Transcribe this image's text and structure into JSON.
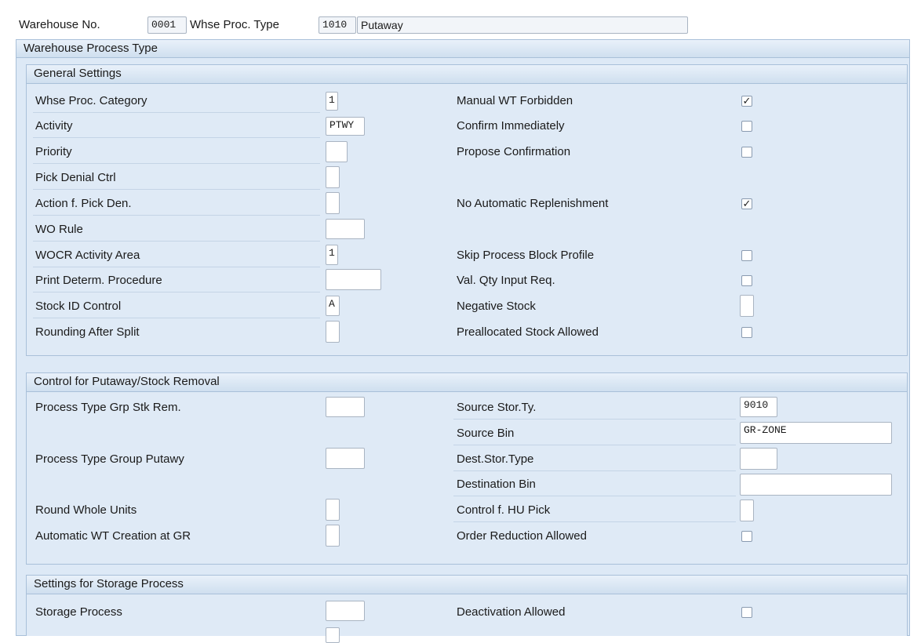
{
  "header": {
    "warehouse_no_label": "Warehouse No.",
    "warehouse_no_value": "0001",
    "proc_type_label": "Whse Proc. Type",
    "proc_type_value": "1010",
    "proc_type_desc": "Putaway"
  },
  "main_panel_title": "Warehouse Process Type",
  "general": {
    "title": "General Settings",
    "rows": [
      {
        "label": "Whse Proc. Category",
        "value": "1"
      },
      {
        "label": "Activity",
        "value": "PTWY"
      },
      {
        "label": "Priority",
        "value": ""
      },
      {
        "label": "Pick Denial Ctrl",
        "value": ""
      },
      {
        "label": "Action f. Pick Den.",
        "value": ""
      },
      {
        "label": "WO Rule",
        "value": ""
      },
      {
        "label": "WOCR Activity Area",
        "value": "1"
      },
      {
        "label": "Print Determ. Procedure",
        "value": ""
      },
      {
        "label": "Stock ID Control",
        "value": "A"
      },
      {
        "label": "Rounding After Split",
        "value": ""
      }
    ],
    "checks": [
      {
        "label": "Manual WT Forbidden",
        "checked": true
      },
      {
        "label": "Confirm Immediately",
        "checked": false
      },
      {
        "label": "Propose Confirmation",
        "checked": false
      },
      {
        "label": "No Automatic Replenishment",
        "checked": true
      },
      {
        "label": "Skip Process Block Profile",
        "checked": false
      },
      {
        "label": "Val. Qty Input Req.",
        "checked": false
      },
      {
        "label": "Negative Stock",
        "value": ""
      },
      {
        "label": "Preallocated Stock Allowed",
        "checked": false
      }
    ]
  },
  "control": {
    "title": "Control for Putaway/Stock Removal",
    "left": [
      {
        "label": "Process Type Grp Stk Rem.",
        "value": ""
      },
      {
        "label": "Process Type Group Putawy",
        "value": ""
      },
      {
        "label": "Round Whole Units",
        "value": ""
      },
      {
        "label": "Automatic WT Creation at GR",
        "value": ""
      }
    ],
    "right": [
      {
        "label": "Source Stor.Ty.",
        "value": "9010"
      },
      {
        "label": "Source Bin",
        "value": "GR-ZONE"
      },
      {
        "label": "Dest.Stor.Type",
        "value": ""
      },
      {
        "label": "Destination Bin",
        "value": ""
      },
      {
        "label": "Control f. HU Pick",
        "value": ""
      },
      {
        "label": "Order Reduction Allowed",
        "checked": false
      }
    ]
  },
  "storage": {
    "title": "Settings for Storage Process",
    "process_label": "Storage Process",
    "process_value": "",
    "deactivation_label": "Deactivation Allowed",
    "deactivation_checked": false
  }
}
